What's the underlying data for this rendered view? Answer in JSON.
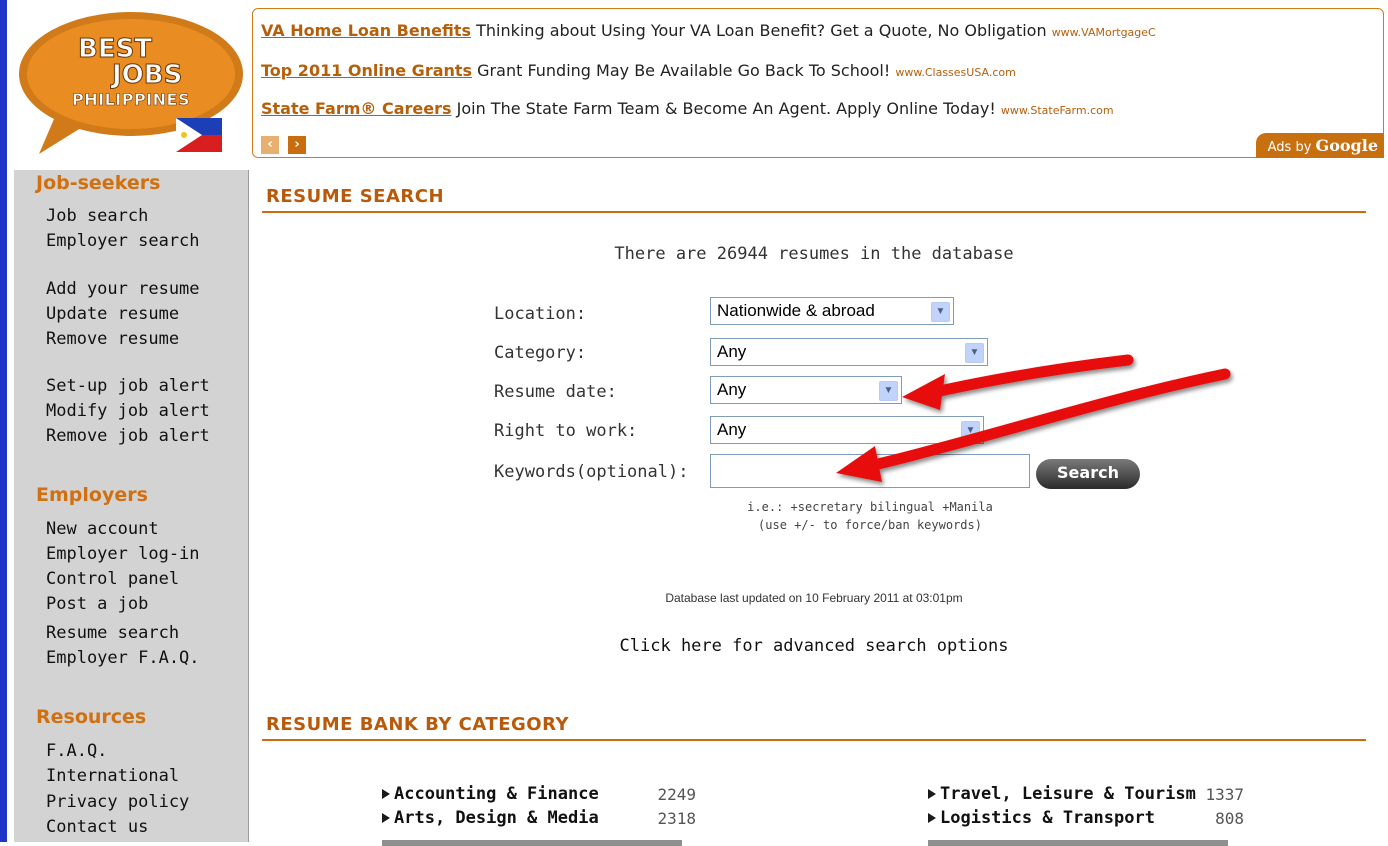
{
  "logo": {
    "line1": "BEST",
    "line2": "JOBS",
    "line3": "PHILIPPINES"
  },
  "ads": {
    "items": [
      {
        "title": "VA Home Loan Benefits",
        "text": "Thinking about Using Your VA Loan Benefit? Get a Quote, No Obligation",
        "url": "www.VAMortgageC"
      },
      {
        "title": "Top 2011 Online Grants",
        "text": "Grant Funding May Be Available Go Back To School!",
        "url": "www.ClassesUSA.com"
      },
      {
        "title": "State Farm® Careers",
        "text": "Join The State Farm Team & Become An Agent. Apply Online Today!",
        "url": "www.StateFarm.com"
      }
    ],
    "ads_by_prefix": "Ads by",
    "ads_by_brand": "Google"
  },
  "sidebar": {
    "jobseekers_title": "Job-seekers",
    "jobseekers": [
      "Job search",
      "Employer search",
      "Add your resume",
      "Update resume",
      "Remove resume",
      "Set-up job alert",
      "Modify job alert",
      "Remove job alert"
    ],
    "employers_title": "Employers",
    "employers": [
      "New account",
      "Employer log-in",
      "Control panel",
      "Post a job",
      "Resume search",
      "Employer F.A.Q."
    ],
    "resources_title": "Resources",
    "resources": [
      "F.A.Q.",
      "International",
      "Privacy policy",
      "Contact us"
    ]
  },
  "search": {
    "title": "RESUME SEARCH",
    "count_text": "There are 26944 resumes in the database",
    "fields": {
      "location_label": "Location:",
      "location_value": "Nationwide & abroad",
      "category_label": "Category:",
      "category_value": "Any",
      "date_label": "Resume date:",
      "date_value": "Any",
      "work_label": "Right to work:",
      "work_value": "Any",
      "keywords_label": "Keywords(optional):",
      "keywords_value": ""
    },
    "search_button": "Search",
    "hint1": "i.e.: +secretary bilingual +Manila",
    "hint2": "(use +/- to force/ban keywords)",
    "updated": "Database last updated on 10 February 2011 at 03:01pm",
    "advanced": "Click here for advanced search options"
  },
  "bank": {
    "title": "RESUME BANK BY CATEGORY",
    "left": [
      {
        "name": "Accounting & Finance",
        "count": "2249"
      },
      {
        "name": "Arts, Design & Media",
        "count": "2318"
      }
    ],
    "right": [
      {
        "name": "Travel, Leisure & Tourism",
        "count": "1337"
      },
      {
        "name": "Logistics & Transport",
        "count": "808"
      }
    ]
  },
  "colors": {
    "accent": "#cc6a12",
    "sidebar_bg": "#d3d3d3",
    "arrow": "#e81010"
  }
}
